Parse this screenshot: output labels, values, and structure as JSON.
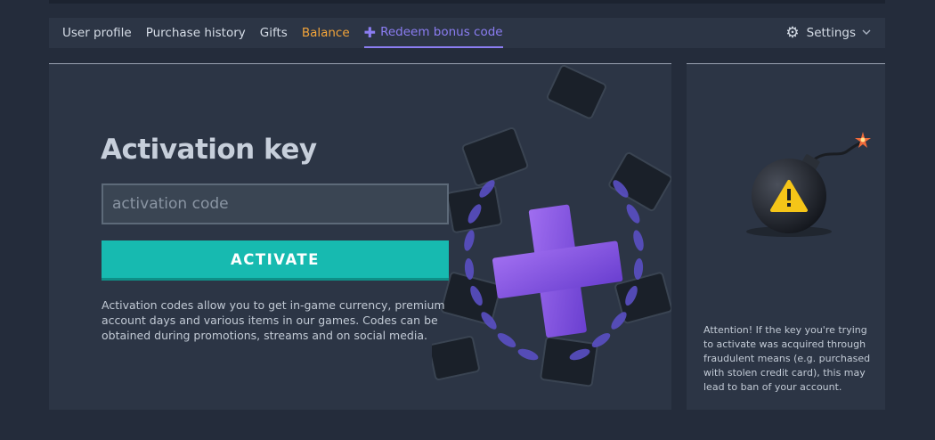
{
  "nav": {
    "items": [
      {
        "label": "User profile"
      },
      {
        "label": "Purchase history"
      },
      {
        "label": "Gifts"
      },
      {
        "label": "Balance"
      },
      {
        "label": "Redeem bonus code"
      }
    ],
    "settings_label": "Settings"
  },
  "main": {
    "title": "Activation key",
    "input_placeholder": "activation code",
    "input_value": "",
    "button_label": "ACTIVATE",
    "description": "Activation codes allow you to get in-game currency, premium account days and various items in our games. Codes can be obtained during promotions, streams and on social media."
  },
  "side": {
    "warning": "Attention! If the key you're trying to activate was acquired through fraudulent means (e.g. purchased with stolen credit card), this may lead to ban of your account."
  },
  "colors": {
    "background": "#242c3b",
    "panel": "#2c3545",
    "accent_active_tab": "#8b7df2",
    "balance": "#f2a43a",
    "button": "#17bab0",
    "warning_icon": "#f5c518"
  },
  "icons": {
    "redeem": "plus-icon",
    "settings": "gear-icon",
    "dropdown": "chevron-down-icon",
    "warning": "warning-bomb-icon"
  }
}
